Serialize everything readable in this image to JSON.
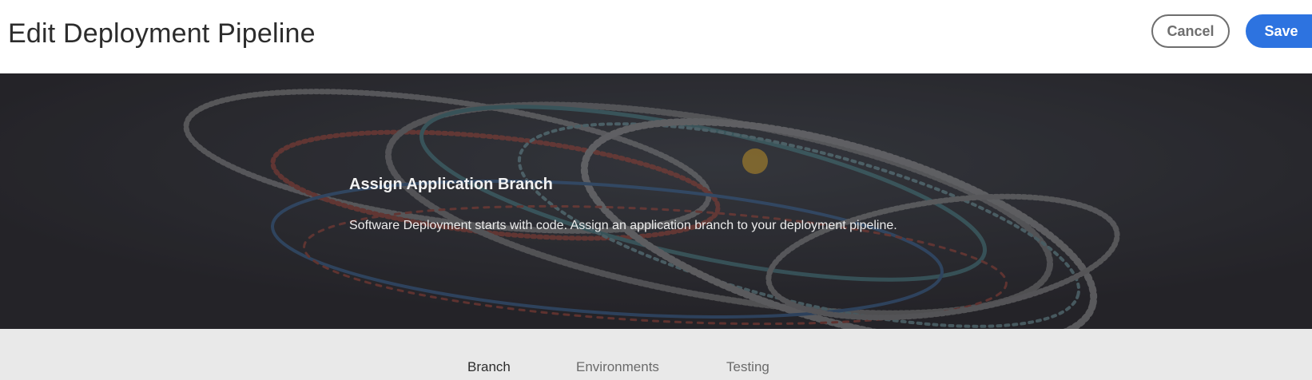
{
  "header": {
    "title": "Edit Deployment Pipeline",
    "cancel_label": "Cancel",
    "save_label": "Save"
  },
  "hero": {
    "title": "Assign Application Branch",
    "description": "Software Deployment starts with code. Assign an application branch to your deployment pipeline."
  },
  "tabs": [
    {
      "label": "Branch",
      "active": true
    },
    {
      "label": "Environments",
      "active": false
    },
    {
      "label": "Testing",
      "active": false
    }
  ],
  "colors": {
    "accent": "#2d73e0",
    "hero_bg": "#2b2a2f",
    "tabbar_bg": "#e9e9e9"
  }
}
